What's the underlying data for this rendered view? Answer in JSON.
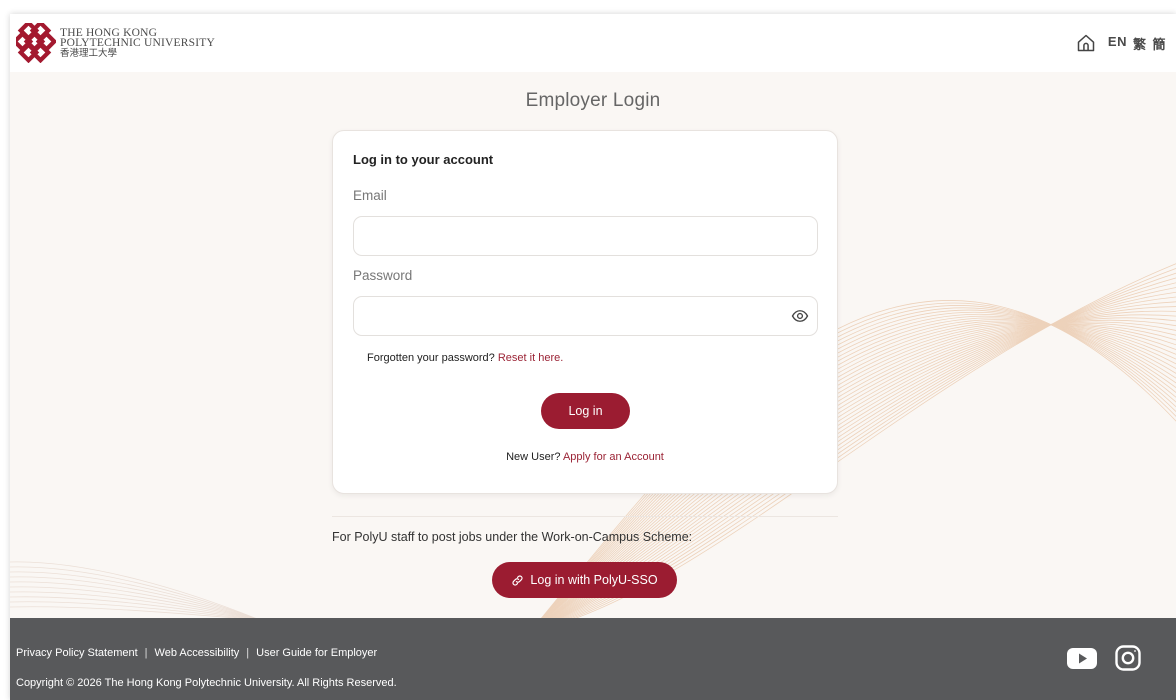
{
  "header": {
    "brand_line1": "THE HONG KONG",
    "brand_line2": "POLYTECHNIC UNIVERSITY",
    "brand_zh": "香港理工大學",
    "lang_en": "EN",
    "lang_tc": "繁",
    "lang_sc": "簡"
  },
  "page_title": "Employer Login",
  "login_card": {
    "heading": "Log in to your account",
    "email_label": "Email",
    "email_value": "",
    "password_label": "Password",
    "password_value": "",
    "forgot_text": "Forgotten your password?",
    "forgot_link": "Reset it here.",
    "login_button": "Log in",
    "new_user_text": "New User?",
    "apply_link": "Apply for an Account"
  },
  "staff": {
    "note": "For PolyU staff to post jobs under the Work-on-Campus Scheme:",
    "sso_button": "Log in with PolyU-SSO"
  },
  "footer": {
    "links": [
      "Privacy Policy Statement",
      "Web Accessibility",
      "User Guide for Employer"
    ],
    "copyright": "Copyright © 2026 The Hong Kong Polytechnic University. All Rights Reserved."
  },
  "icons": {
    "home": "home-icon",
    "eye": "eye-icon",
    "link": "link-icon",
    "youtube": "youtube-icon",
    "instagram": "instagram-icon"
  },
  "colors": {
    "accent": "#9b1c31",
    "footer_bg": "#58595b",
    "page_bg": "#faf7f4"
  }
}
